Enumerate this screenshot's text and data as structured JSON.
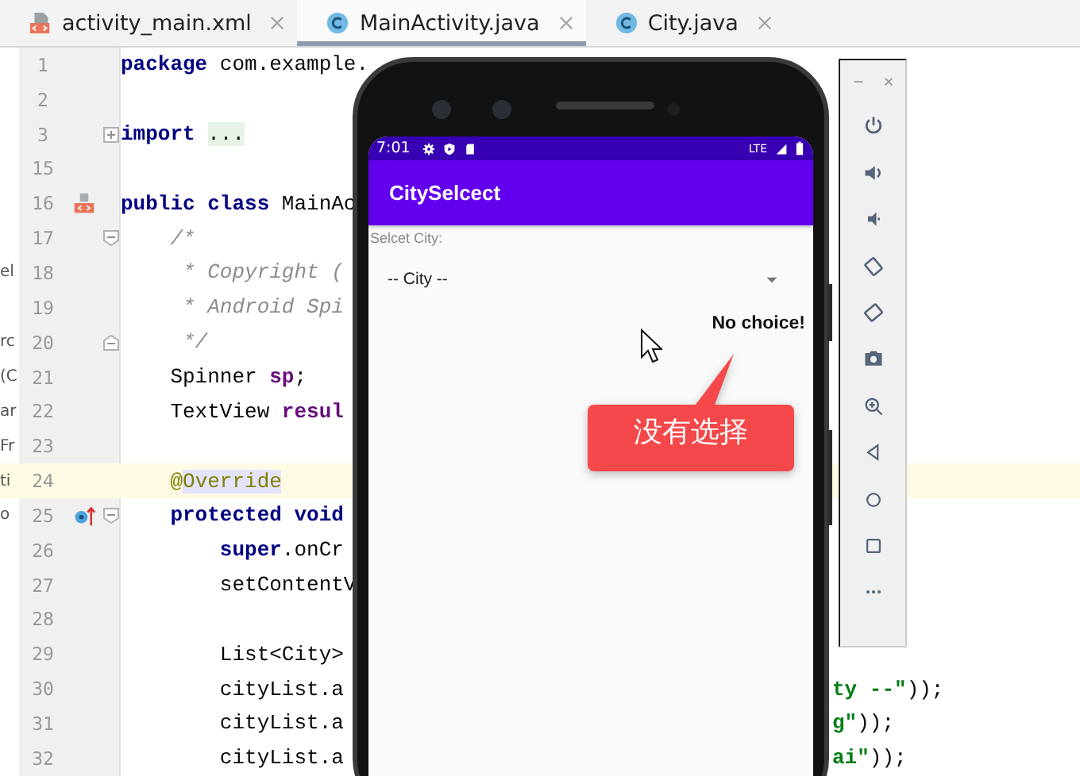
{
  "tabs": [
    {
      "label": "activity_main.xml",
      "kind": "layout",
      "selected": false
    },
    {
      "label": "MainActivity.java",
      "kind": "class",
      "selected": true
    },
    {
      "label": "City.java",
      "kind": "class",
      "selected": false
    }
  ],
  "editor": {
    "lines": [
      {
        "number": "1",
        "tokens": [
          {
            "kind": "kw",
            "text": "package"
          },
          {
            "kind": "plain",
            "text": " com.example."
          }
        ]
      },
      {
        "number": "2"
      },
      {
        "number": "3",
        "fold": {
          "kind": "expand"
        },
        "tokens": [
          {
            "kind": "kw",
            "text": "import "
          },
          {
            "kind": "folded",
            "text": "..."
          }
        ]
      },
      {
        "number": "15"
      },
      {
        "number": "16",
        "marker": {
          "kind": "layout"
        },
        "tokens": [
          {
            "kind": "kw",
            "text": "public class"
          },
          {
            "kind": "plain",
            "text": " MainAc"
          }
        ]
      },
      {
        "number": "17",
        "fold": {
          "kind": "start"
        },
        "tokens": [
          {
            "kind": "comment",
            "text": "    /*"
          }
        ]
      },
      {
        "number": "18",
        "panel_text": "el",
        "tokens": [
          {
            "kind": "comment",
            "text": "     * Copyright ("
          }
        ]
      },
      {
        "number": "19",
        "tokens": [
          {
            "kind": "comment",
            "text": "     * Android Spi"
          }
        ]
      },
      {
        "number": "20",
        "fold": {
          "kind": "end"
        },
        "panel_text": "rc",
        "tokens": [
          {
            "kind": "comment",
            "text": "     */"
          }
        ]
      },
      {
        "number": "21",
        "panel_text": "(C",
        "tokens": [
          {
            "kind": "plain",
            "text": "    Spinner "
          },
          {
            "kind": "field",
            "text": "sp"
          },
          {
            "kind": "plain",
            "text": ";"
          }
        ]
      },
      {
        "number": "22",
        "panel_text": "ar",
        "tokens": [
          {
            "kind": "plain",
            "text": "    TextView "
          },
          {
            "kind": "field",
            "text": "resul"
          }
        ]
      },
      {
        "number": "23",
        "panel_text": "Fr"
      },
      {
        "number": "24",
        "current": true,
        "panel_text": "ti",
        "tokens": [
          {
            "kind": "annotation",
            "text": "    @"
          },
          {
            "kind": "annotation_hl",
            "text": "Override"
          }
        ]
      },
      {
        "number": "25",
        "marker": {
          "kind": "override"
        },
        "fold": {
          "kind": "start"
        },
        "panel_text": "o",
        "tokens": [
          {
            "kind": "kw",
            "text": "    protected void"
          }
        ]
      },
      {
        "number": "26",
        "tokens": [
          {
            "kind": "kw",
            "text": "        super"
          },
          {
            "kind": "plain",
            "text": ".onCr"
          }
        ]
      },
      {
        "number": "27",
        "tokens": [
          {
            "kind": "plain",
            "text": "        setContentV"
          }
        ]
      },
      {
        "number": "28"
      },
      {
        "number": "29",
        "tokens": [
          {
            "kind": "plain",
            "text": "        List<City>"
          }
        ]
      },
      {
        "number": "30",
        "tokens": [
          {
            "kind": "plain",
            "text": "        cityList.a"
          }
        ],
        "right_tokens": [
          {
            "kind": "string",
            "text": "ty --\""
          },
          {
            "kind": "plain",
            "text": "));"
          }
        ]
      },
      {
        "number": "31",
        "tokens": [
          {
            "kind": "plain",
            "text": "        cityList.a"
          }
        ],
        "right_tokens": [
          {
            "kind": "string",
            "text": "g\""
          },
          {
            "kind": "plain",
            "text": "));"
          }
        ]
      },
      {
        "number": "32",
        "tokens": [
          {
            "kind": "plain",
            "text": "        cityList.a"
          }
        ],
        "right_tokens": [
          {
            "kind": "string",
            "text": "ai\""
          },
          {
            "kind": "plain",
            "text": "));"
          }
        ]
      }
    ]
  },
  "phone": {
    "status_bar": {
      "time": "7:01",
      "network": "LTE"
    },
    "app_title": "CitySelcect",
    "prompt": "Selcet City:",
    "spinner": "-- City --",
    "result": "No choice!"
  },
  "callout": {
    "text": "没有选择"
  },
  "emulator_toolbar": {
    "buttons": [
      {
        "kind": "power"
      },
      {
        "kind": "volume_up"
      },
      {
        "kind": "volume_down"
      },
      {
        "kind": "rotate_left"
      },
      {
        "kind": "rotate_right"
      },
      {
        "kind": "camera"
      },
      {
        "kind": "zoom"
      },
      {
        "kind": "back"
      },
      {
        "kind": "home"
      },
      {
        "kind": "overview"
      },
      {
        "kind": "more"
      }
    ]
  }
}
